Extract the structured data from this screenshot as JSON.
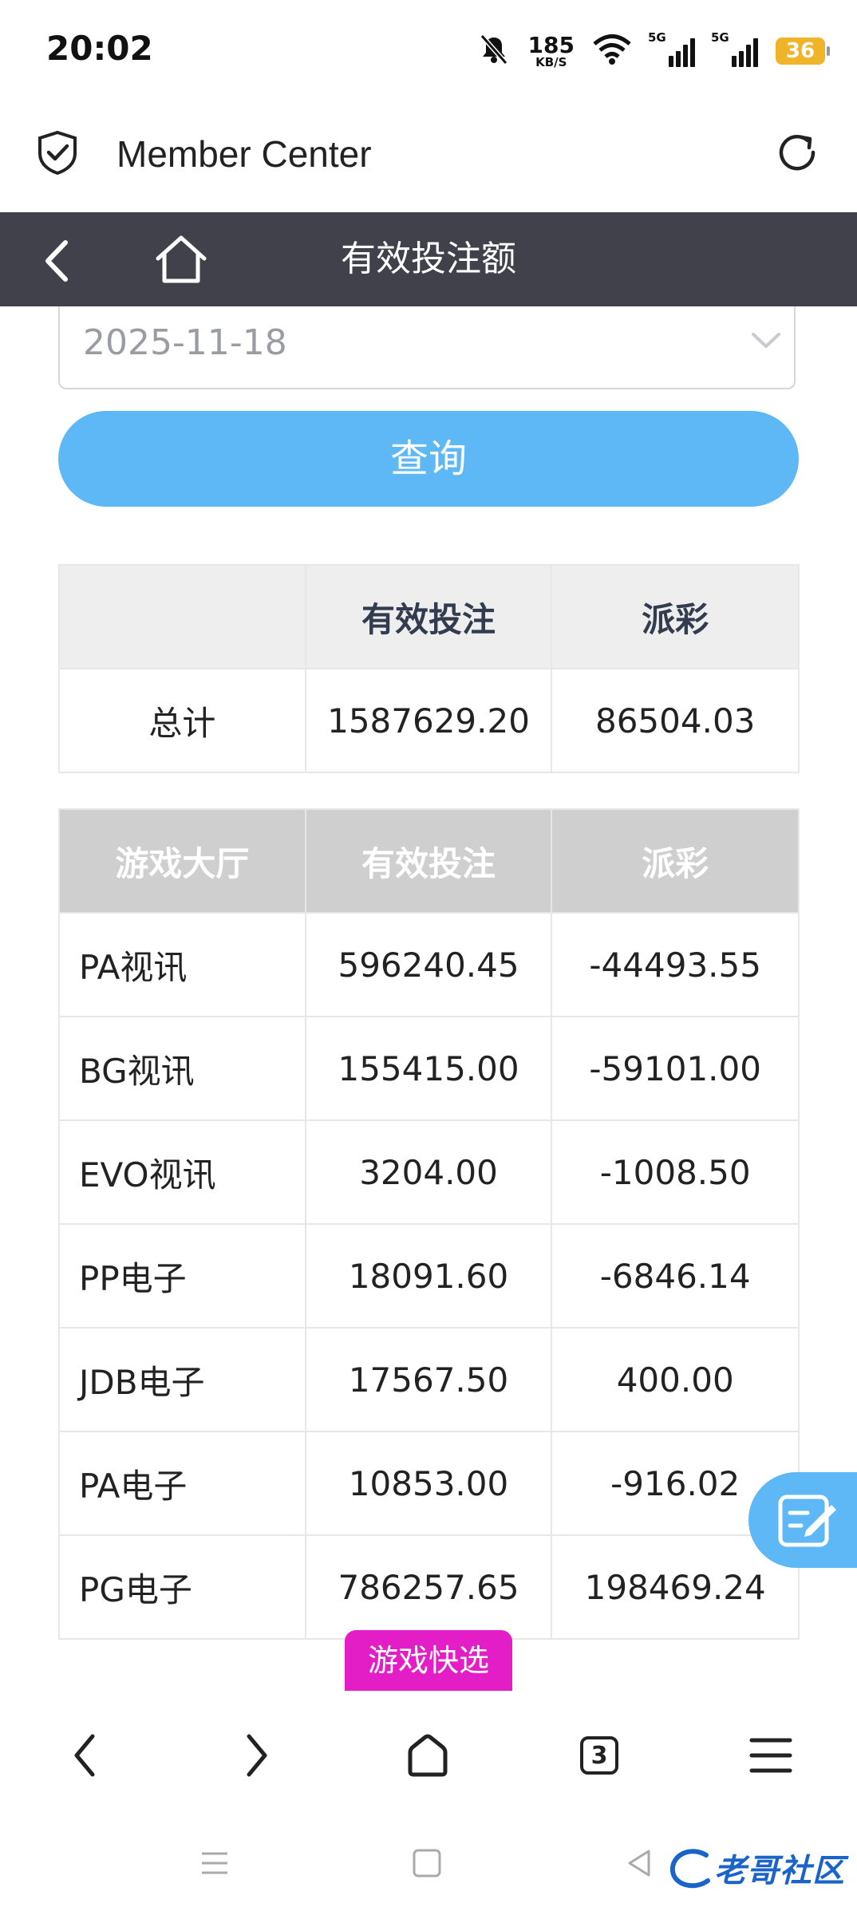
{
  "status_bar": {
    "time": "20:02",
    "net_speed_value": "185",
    "net_speed_unit": "KB/S",
    "signal_label_1": "5G",
    "signal_label_2": "5G",
    "battery_level": "36"
  },
  "browser": {
    "site_title": "Member Center"
  },
  "header": {
    "title": "有效投注额"
  },
  "filter": {
    "date_value": "2025-11-18",
    "query_label": "查询"
  },
  "summary": {
    "headers": [
      "",
      "有效投注",
      "派彩"
    ],
    "row": {
      "label": "总计",
      "valid_bet": "1587629.20",
      "payout": "86504.03"
    }
  },
  "detail": {
    "headers": [
      "游戏大厅",
      "有效投注",
      "派彩"
    ],
    "rows": [
      {
        "hall": "PA视讯",
        "valid_bet": "596240.45",
        "payout": "-44493.55"
      },
      {
        "hall": "BG视讯",
        "valid_bet": "155415.00",
        "payout": "-59101.00"
      },
      {
        "hall": "EVO视讯",
        "valid_bet": "3204.00",
        "payout": "-1008.50"
      },
      {
        "hall": "PP电子",
        "valid_bet": "18091.60",
        "payout": "-6846.14"
      },
      {
        "hall": "JDB电子",
        "valid_bet": "17567.50",
        "payout": "400.00"
      },
      {
        "hall": "PA电子",
        "valid_bet": "10853.00",
        "payout": "-916.02"
      },
      {
        "hall": "PG电子",
        "valid_bet": "786257.65",
        "payout": "198469.24"
      }
    ]
  },
  "game_quick_select": "游戏快选",
  "browser_nav": {
    "tab_count": "3"
  },
  "watermark": "老哥社区",
  "colors": {
    "header_bg": "#40414a",
    "accent_blue": "#5db8f5",
    "quick_select_magenta": "#e31ec6"
  }
}
